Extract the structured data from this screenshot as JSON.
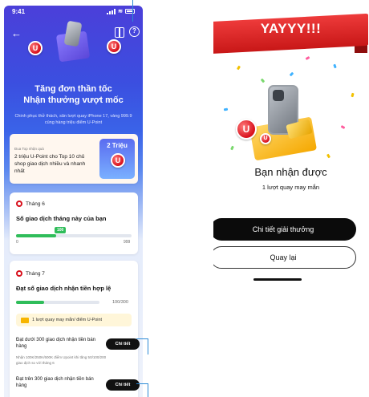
{
  "left": {
    "status_time": "9:41",
    "hero_title_line1": "Tăng đơn thần tốc",
    "hero_title_line2": "Nhận thưởng vượt mốc",
    "hero_subtitle": "Chinh phục thử thách, săn lượt quay iPhone 17, vàng 999.9 cùng hàng triệu điểm U-Point",
    "prize_card": {
      "small_label": "Đua Top nhận quà",
      "text": "2 triệu U-Point cho Top 10 chủ shop giao dịch nhiều và nhanh nhất",
      "badge": "2 Triệu"
    },
    "month6": {
      "month_label": "Tháng 6",
      "title": "Số giao dịch tháng này của bạn",
      "progress_value": 100,
      "progress_max": 999,
      "tooltip": "100",
      "axis_min": "0",
      "axis_max": "999"
    },
    "month7": {
      "month_label": "Tháng 7",
      "title": "Đạt số giao dịch nhận tiền hợp lệ",
      "progress_value": 100,
      "progress_max": 300,
      "progress_text": "100/300",
      "reward_text": "1 lượt quay may mắn/ điểm U-Point",
      "cond1": "Đạt dưới 300 giao dịch nhận tiền bán hàng",
      "cond1_note": "Nhận 100K/250K/600K điểm Upoint khi tăng 50/100/200 giao dịch so với tháng 6",
      "cond2": "Đạt trên 300 giao dịch nhận tiền bán hàng",
      "detail_label": "Chi tiết"
    }
  },
  "right": {
    "ribbon": "YAYYY!!!",
    "title": "Bạn nhận được",
    "subtitle": "1 lượt quay may mắn",
    "primary_button": "Chi tiết giải thưởng",
    "secondary_button": "Quay lại"
  },
  "colors": {
    "accent_red": "#d8101c",
    "progress_green": "#2fbd5a",
    "callout_blue": "#2d8bd6"
  }
}
